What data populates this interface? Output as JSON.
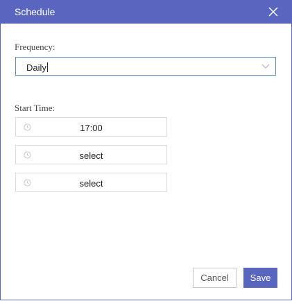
{
  "dialog": {
    "title": "Schedule",
    "close_icon": "close-icon",
    "accent_color": "#5966c0"
  },
  "frequency": {
    "label": "Frequency:",
    "value": "Daily",
    "dropdown_icon": "chevron-down-icon"
  },
  "start_time": {
    "label": "Start Time:",
    "slots": [
      {
        "value": "17:00",
        "icon": "clock-icon"
      },
      {
        "value": "select",
        "icon": "clock-icon"
      },
      {
        "value": "select",
        "icon": "clock-icon"
      }
    ]
  },
  "buttons": {
    "cancel": "Cancel",
    "save": "Save"
  }
}
